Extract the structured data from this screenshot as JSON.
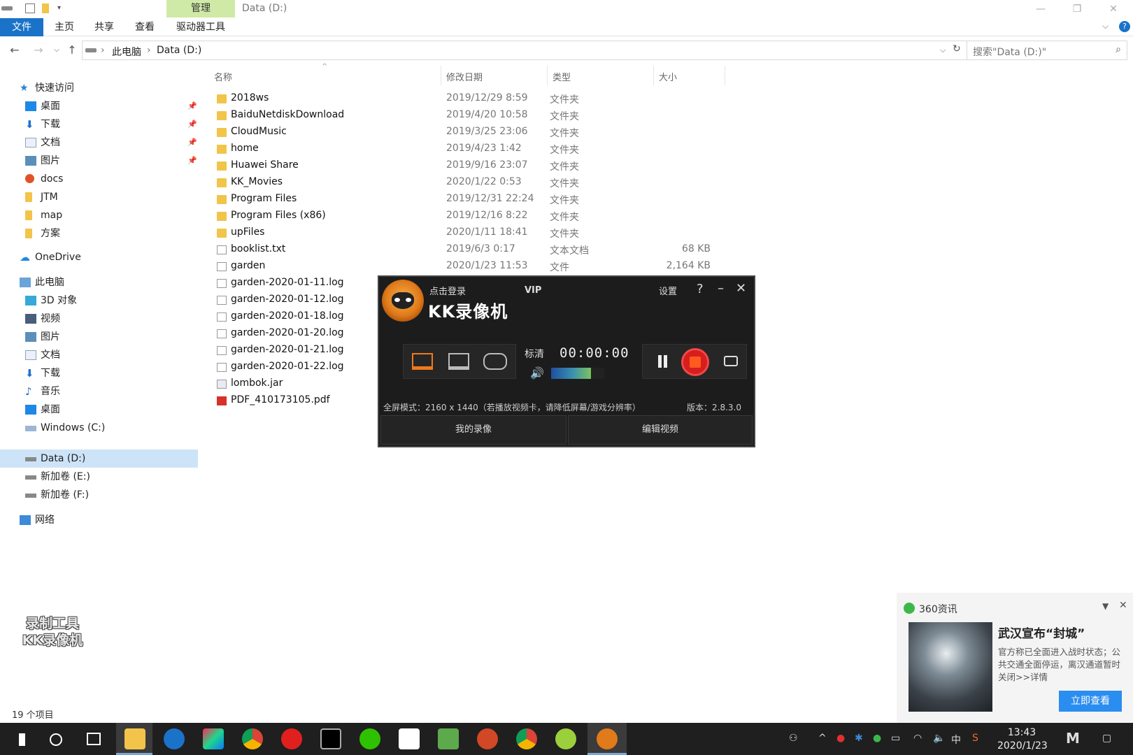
{
  "window": {
    "context_tab": "管理",
    "title": "Data (D:)"
  },
  "ribbon": {
    "tabs": [
      "文件",
      "主页",
      "共享",
      "查看",
      "驱动器工具"
    ]
  },
  "address": {
    "crumbs": [
      "此电脑",
      "Data (D:)"
    ],
    "search_placeholder": "搜索\"Data (D:)\""
  },
  "nav": {
    "quick_access": "快速访问",
    "quick_items": [
      "桌面",
      "下载",
      "文档",
      "图片",
      "docs",
      "JTM",
      "map",
      "方案"
    ],
    "onedrive": "OneDrive",
    "this_pc": "此电脑",
    "pc_items": [
      "3D 对象",
      "视频",
      "图片",
      "文档",
      "下载",
      "音乐",
      "桌面",
      "Windows (C:)",
      "Data (D:)",
      "新加卷 (E:)",
      "新加卷 (F:)"
    ],
    "network": "网络",
    "selected": "Data (D:)"
  },
  "columns": [
    "名称",
    "修改日期",
    "类型",
    "大小"
  ],
  "files": [
    {
      "name": "2018ws",
      "date": "2019/12/29 8:59",
      "type": "文件夹",
      "size": "",
      "kind": "folder"
    },
    {
      "name": "BaiduNetdiskDownload",
      "date": "2019/4/20 10:58",
      "type": "文件夹",
      "size": "",
      "kind": "folder"
    },
    {
      "name": "CloudMusic",
      "date": "2019/3/25 23:06",
      "type": "文件夹",
      "size": "",
      "kind": "folder"
    },
    {
      "name": "home",
      "date": "2019/4/23 1:42",
      "type": "文件夹",
      "size": "",
      "kind": "folder"
    },
    {
      "name": "Huawei Share",
      "date": "2019/9/16 23:07",
      "type": "文件夹",
      "size": "",
      "kind": "folder"
    },
    {
      "name": "KK_Movies",
      "date": "2020/1/22 0:53",
      "type": "文件夹",
      "size": "",
      "kind": "folder"
    },
    {
      "name": "Program Files",
      "date": "2019/12/31 22:24",
      "type": "文件夹",
      "size": "",
      "kind": "folder"
    },
    {
      "name": "Program Files (x86)",
      "date": "2019/12/16 8:22",
      "type": "文件夹",
      "size": "",
      "kind": "folder"
    },
    {
      "name": "upFiles",
      "date": "2020/1/11 18:41",
      "type": "文件夹",
      "size": "",
      "kind": "folder"
    },
    {
      "name": "booklist.txt",
      "date": "2019/6/3 0:17",
      "type": "文本文档",
      "size": "68 KB",
      "kind": "file"
    },
    {
      "name": "garden",
      "date": "2020/1/23 11:53",
      "type": "文件",
      "size": "2,164 KB",
      "kind": "file"
    },
    {
      "name": "garden-2020-01-11.log",
      "date": "",
      "type": "",
      "size": "",
      "kind": "file"
    },
    {
      "name": "garden-2020-01-12.log",
      "date": "",
      "type": "",
      "size": "",
      "kind": "file"
    },
    {
      "name": "garden-2020-01-18.log",
      "date": "",
      "type": "",
      "size": "",
      "kind": "file"
    },
    {
      "name": "garden-2020-01-20.log",
      "date": "",
      "type": "",
      "size": "",
      "kind": "file"
    },
    {
      "name": "garden-2020-01-21.log",
      "date": "",
      "type": "",
      "size": "",
      "kind": "file"
    },
    {
      "name": "garden-2020-01-22.log",
      "date": "",
      "type": "",
      "size": "",
      "kind": "file"
    },
    {
      "name": "lombok.jar",
      "date": "",
      "type": "",
      "size": "",
      "kind": "jar"
    },
    {
      "name": "PDF_410173105.pdf",
      "date": "",
      "type": "",
      "size": "",
      "kind": "pdf"
    }
  ],
  "status": "19 个项目",
  "kk": {
    "login": "点击登录",
    "vip": "VIP",
    "settings": "设置",
    "help": "?",
    "minimize": "–",
    "close": "✕",
    "brand": "KK录像机",
    "quality": "标清",
    "timer": "00:00:00",
    "info": "全屏模式：2160 x 1440（若播放视频卡，请降低屏幕/游戏分辨率）",
    "version": "版本：2.8.3.0",
    "my_recordings": "我的录像",
    "edit_video": "编辑视频",
    "volume_level": 0.75
  },
  "watermark": [
    "录制工具",
    "KK录像机"
  ],
  "news": {
    "source": "360资讯",
    "title": "武汉宣布“封城”",
    "body": "官方称已全面进入战时状态；公共交通全面停运，离汉通道暂时关闭>>详情",
    "cta": "立即查看"
  },
  "taskbar": {
    "time": "13:43",
    "date": "2020/1/23",
    "ime": "中"
  },
  "colors": {
    "accent": "#1a73c8",
    "context_tab": "#cfeaa6",
    "folder": "#f2c44a",
    "record": "#d81d1d"
  }
}
